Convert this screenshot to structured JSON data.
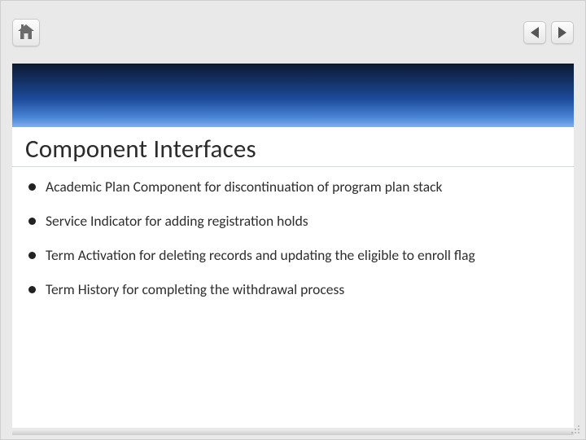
{
  "title": "Component Interfaces",
  "bullets": [
    "Academic Plan Component for discontinuation of program plan stack",
    "Service Indicator for adding registration holds",
    "Term Activation for deleting records and updating the eligible to enroll flag",
    "Term History for completing the withdrawal process"
  ]
}
